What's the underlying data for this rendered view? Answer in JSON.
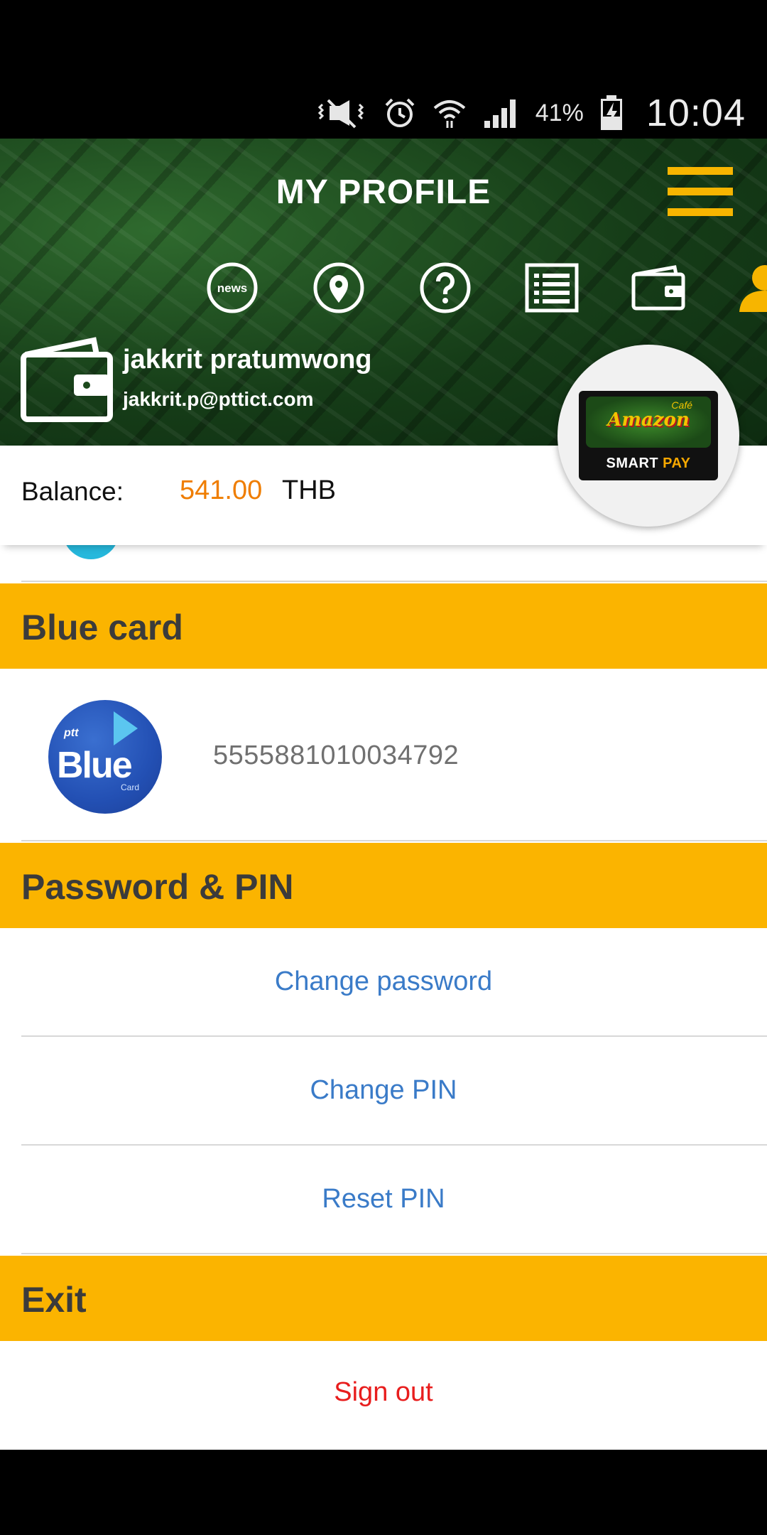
{
  "status_bar": {
    "battery_percent": "41%",
    "time": "10:04",
    "icons": [
      "mute-vibrate-icon",
      "alarm-icon",
      "wifi-icon",
      "signal-icon",
      "battery-charging-icon"
    ]
  },
  "header": {
    "title": "MY PROFILE",
    "nav_icons": [
      {
        "name": "news-icon",
        "label": "news"
      },
      {
        "name": "location-icon"
      },
      {
        "name": "help-icon"
      },
      {
        "name": "list-icon"
      },
      {
        "name": "wallet-icon"
      },
      {
        "name": "profile-icon",
        "active": true
      }
    ],
    "accent_color": "#f7b500"
  },
  "user": {
    "name": "jakkrit pratumwong",
    "email": "jakkrit.p@pttict.com"
  },
  "card_image": {
    "brand": "Amazon",
    "cafe": "Café",
    "smart": "SMART",
    "pay": "PAY"
  },
  "balance": {
    "label": "Balance:",
    "amount": "541.00",
    "currency": "THB",
    "amount_color": "#ef7d00"
  },
  "sections": {
    "blue_card": {
      "title": "Blue card",
      "logo_ptt": "ptt",
      "logo_word": "Blue",
      "logo_card": "Card",
      "card_number": "5555881010034792"
    },
    "password_pin": {
      "title": "Password & PIN",
      "change_password": "Change password",
      "change_pin": "Change PIN",
      "reset_pin": "Reset PIN"
    },
    "exit": {
      "title": "Exit",
      "sign_out": "Sign out"
    }
  }
}
